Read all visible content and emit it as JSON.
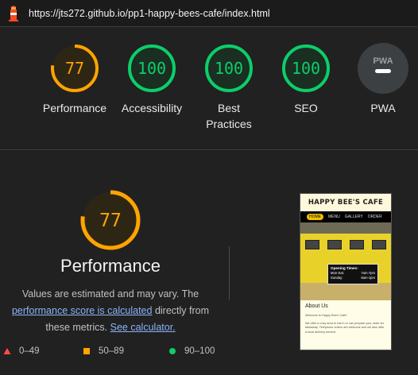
{
  "topbar": {
    "icon": "lighthouse-icon",
    "url": "https://jts272.github.io/pp1-happy-bees-cafe/index.html"
  },
  "colors": {
    "pass": "#0cce6b",
    "average": "#ffa400",
    "fail": "#ff4e42",
    "pwa_gray": "#5f6368"
  },
  "gauges": [
    {
      "label": "Performance",
      "score": "77",
      "value": 77,
      "rating": "average"
    },
    {
      "label": "Accessibility",
      "score": "100",
      "value": 100,
      "rating": "pass"
    },
    {
      "label": "Best Practices",
      "score": "100",
      "value": 100,
      "rating": "pass"
    },
    {
      "label": "SEO",
      "score": "100",
      "value": 100,
      "rating": "pass"
    },
    {
      "label": "PWA",
      "badge": "PWA",
      "rating": "na"
    }
  ],
  "performance": {
    "score": "77",
    "value": 77,
    "title": "Performance",
    "desc_prefix": "Values are estimated and may vary. The",
    "desc_link1": "performance score is calculated",
    "desc_middle": "directly from these metrics.",
    "desc_link2": "See calculator."
  },
  "legend": [
    {
      "range": "0–49",
      "shape": "triangle",
      "color": "#ff4e42"
    },
    {
      "range": "50–89",
      "shape": "square",
      "color": "#ffa400"
    },
    {
      "range": "90–100",
      "shape": "circle",
      "color": "#0cce6b"
    }
  ],
  "screenshot": {
    "site_title": "HAPPY BEE'S CAFE",
    "nav": [
      "HOME",
      "MENU",
      "GALLERY",
      "ORDER"
    ],
    "hours_title": "Opening Times:",
    "hours": [
      {
        "days": "Mon-Sat:",
        "time": "7am-7pm"
      },
      {
        "days": "Sunday:",
        "time": "8am-1pm"
      }
    ],
    "about_heading": "About Us",
    "about_p1": "Welcome to Happy Bee's Cafe!",
    "about_p2": "We offer a cosy area to eat in or can prepare your order for takeaway. Telephone orders are welcome and we also offer a local delivery service."
  }
}
